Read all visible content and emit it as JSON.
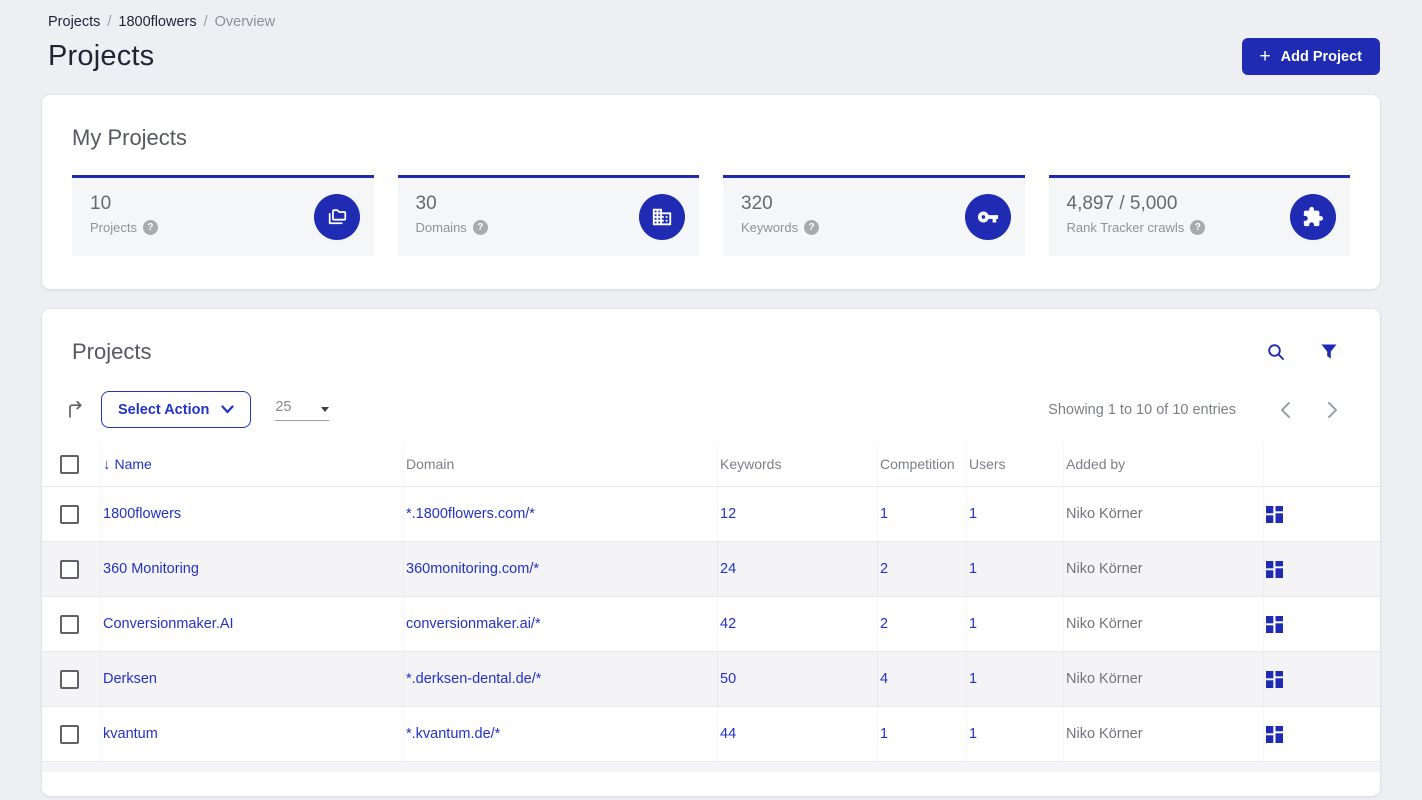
{
  "colors": {
    "primary": "#1e2bb2",
    "link": "#2233c5",
    "page_bg": "#edeff2"
  },
  "breadcrumb": {
    "items": [
      "Projects",
      "1800flowers",
      "Overview"
    ],
    "separator": "/"
  },
  "page": {
    "title": "Projects"
  },
  "header": {
    "add_project_label": "Add Project",
    "add_icon": "+"
  },
  "icons": {
    "sort_desc": "↓",
    "help": "?"
  },
  "my_projects": {
    "title": "My Projects",
    "stats": [
      {
        "value": "10",
        "label": "Projects",
        "icon": "folder-copy-icon"
      },
      {
        "value": "30",
        "label": "Domains",
        "icon": "building-icon"
      },
      {
        "value": "320",
        "label": "Keywords",
        "icon": "key-icon"
      },
      {
        "value": "4,897 / 5,000",
        "label": "Rank Tracker crawls",
        "icon": "puzzle-icon"
      }
    ]
  },
  "projects_panel": {
    "title": "Projects",
    "select_action_label": "Select Action",
    "page_size": "25",
    "showing_text": "Showing 1 to 10 of 10 entries",
    "columns": {
      "name": "Name",
      "domain": "Domain",
      "keywords": "Keywords",
      "competition": "Competition",
      "users": "Users",
      "added_by": "Added by"
    },
    "sorted_column": "Name",
    "sort_direction": "desc",
    "rows": [
      {
        "name": "1800flowers",
        "domain": "*.1800flowers.com/*",
        "keywords": "12",
        "competition": "1",
        "users": "1",
        "added_by": "Niko Körner"
      },
      {
        "name": "360 Monitoring",
        "domain": "360monitoring.com/*",
        "keywords": "24",
        "competition": "2",
        "users": "1",
        "added_by": "Niko Körner"
      },
      {
        "name": "Conversionmaker.AI",
        "domain": "conversionmaker.ai/*",
        "keywords": "42",
        "competition": "2",
        "users": "1",
        "added_by": "Niko Körner"
      },
      {
        "name": "Derksen",
        "domain": "*.derksen-dental.de/*",
        "keywords": "50",
        "competition": "4",
        "users": "1",
        "added_by": "Niko Körner"
      },
      {
        "name": "kvantum",
        "domain": "*.kvantum.de/*",
        "keywords": "44",
        "competition": "1",
        "users": "1",
        "added_by": "Niko Körner"
      }
    ]
  }
}
